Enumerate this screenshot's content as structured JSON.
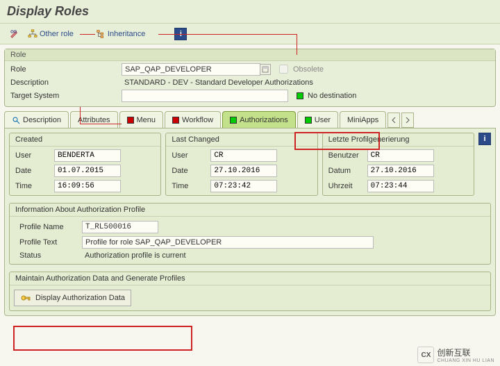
{
  "page_title": "Display Roles",
  "toolbar": {
    "other_role": "Other role",
    "inheritance": "Inheritance"
  },
  "role_panel": {
    "title": "Role",
    "role_label": "Role",
    "role_value": "SAP_QAP_DEVELOPER",
    "obsolete_label": "Obsolete",
    "description_label": "Description",
    "description_value": "STANDARD - DEV - Standard Developer Authorizations",
    "target_label": "Target System",
    "target_value": "",
    "target_status": "No destination"
  },
  "tabs": {
    "description": "Description",
    "attributes": "Attributes",
    "menu": "Menu",
    "workflow": "Workflow",
    "authorizations": "Authorizations",
    "user": "User",
    "miniapps": "MiniApps"
  },
  "groups": {
    "created": {
      "title": "Created",
      "user_lbl": "User",
      "user": "BENDERTA",
      "date_lbl": "Date",
      "date": "01.07.2015",
      "time_lbl": "Time",
      "time": "16:09:56"
    },
    "changed": {
      "title": "Last Changed",
      "user_lbl": "User",
      "user": "CR",
      "date_lbl": "Date",
      "date": "27.10.2016",
      "time_lbl": "Time",
      "time": "07:23:42"
    },
    "profgen": {
      "title": "Letzte Profilgenerierung",
      "user_lbl": "Benutzer",
      "user": "CR",
      "date_lbl": "Datum",
      "date": "27.10.2016",
      "time_lbl": "Uhrzeit",
      "time": "07:23:44"
    }
  },
  "profile": {
    "title": "Information About Authorization Profile",
    "name_lbl": "Profile Name",
    "name": "T_RL500016",
    "text_lbl": "Profile Text",
    "text": "Profile for role SAP_QAP_DEVELOPER",
    "status_lbl": "Status",
    "status": "Authorization profile is current"
  },
  "maintain": {
    "title": "Maintain Authorization Data and Generate Profiles",
    "display_btn": "Display Authorization Data"
  },
  "watermark": {
    "brand": "创新互联",
    "sub": "CHUANG XIN HU LIAN"
  }
}
